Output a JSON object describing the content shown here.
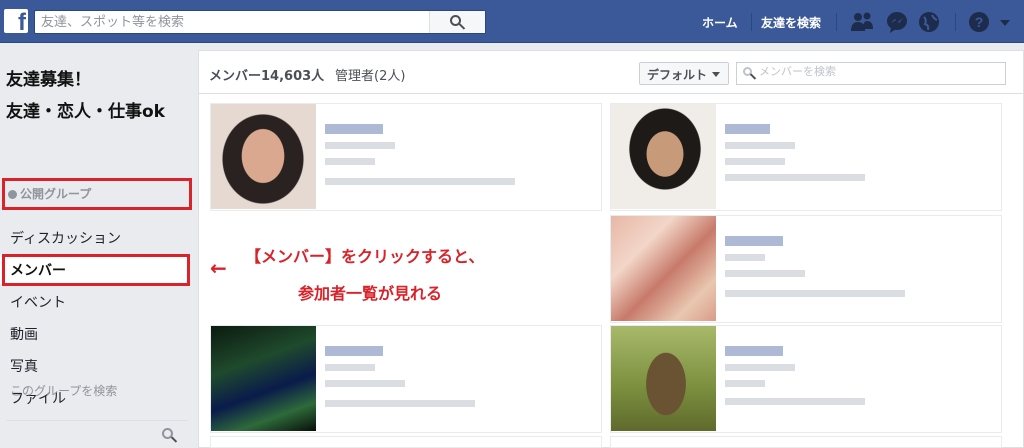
{
  "topbar": {
    "logo": "f",
    "search_placeholder": "友達、スポット等を検索",
    "nav": {
      "home": "ホーム",
      "find_friends": "友達を検索"
    },
    "icons": [
      "friend-requests-icon",
      "messenger-icon",
      "notifications-globe-icon",
      "help-icon",
      "account-menu-caret-icon"
    ]
  },
  "sidebar": {
    "group_title_1": "友達募集！",
    "group_title_2": "友達・恋人・仕事ok",
    "group_type": "公開グループ",
    "items": [
      {
        "label": "ディスカッション"
      },
      {
        "label": "メンバー"
      },
      {
        "label": "イベント"
      },
      {
        "label": "動画"
      },
      {
        "label": "写真"
      },
      {
        "label": "ファイル"
      }
    ],
    "search_placeholder": "このグループを検索"
  },
  "main": {
    "members_label": "メンバー14,603人",
    "admins_label": "管理者(2人)",
    "sort_label": "デフォルト",
    "search_placeholder": "メンバーを検索"
  },
  "annotation": {
    "arrow": "←",
    "line1": "【メンバー】をクリックすると、",
    "line2": "参加者一覧が見れる"
  },
  "colors": {
    "brand": "#3b5998",
    "annotation_red": "#d9222a"
  }
}
